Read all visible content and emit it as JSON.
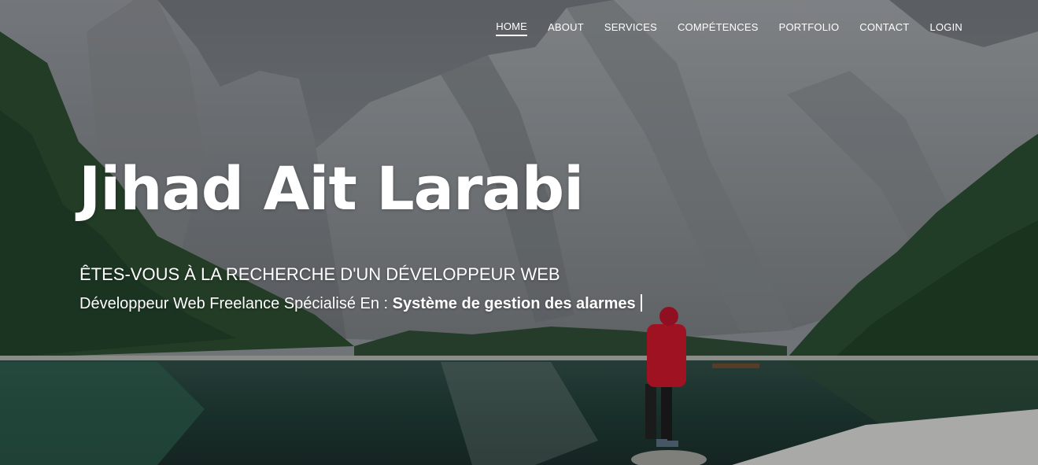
{
  "nav": {
    "items": [
      {
        "label": "HOME",
        "active": true
      },
      {
        "label": "ABOUT",
        "active": false
      },
      {
        "label": "SERVICES",
        "active": false
      },
      {
        "label": "COMPÉTENCES",
        "active": false
      },
      {
        "label": "PORTFOLIO",
        "active": false
      },
      {
        "label": "CONTACT",
        "active": false
      },
      {
        "label": "LOGIN",
        "active": false
      }
    ]
  },
  "hero": {
    "name": "Jihad Ait Larabi",
    "tagline": "ÊTES-VOUS À LA RECHERCHE D'UN DÉVELOPPEUR WEB",
    "subtitle_prefix": "Développeur Web Freelance Spécialisé En :",
    "typed_text": "Système de gestion des alarmes"
  },
  "colors": {
    "text": "#ffffff",
    "jacket": "#c2162a"
  },
  "icons": {
    "background": "mountain-lake-photo"
  }
}
